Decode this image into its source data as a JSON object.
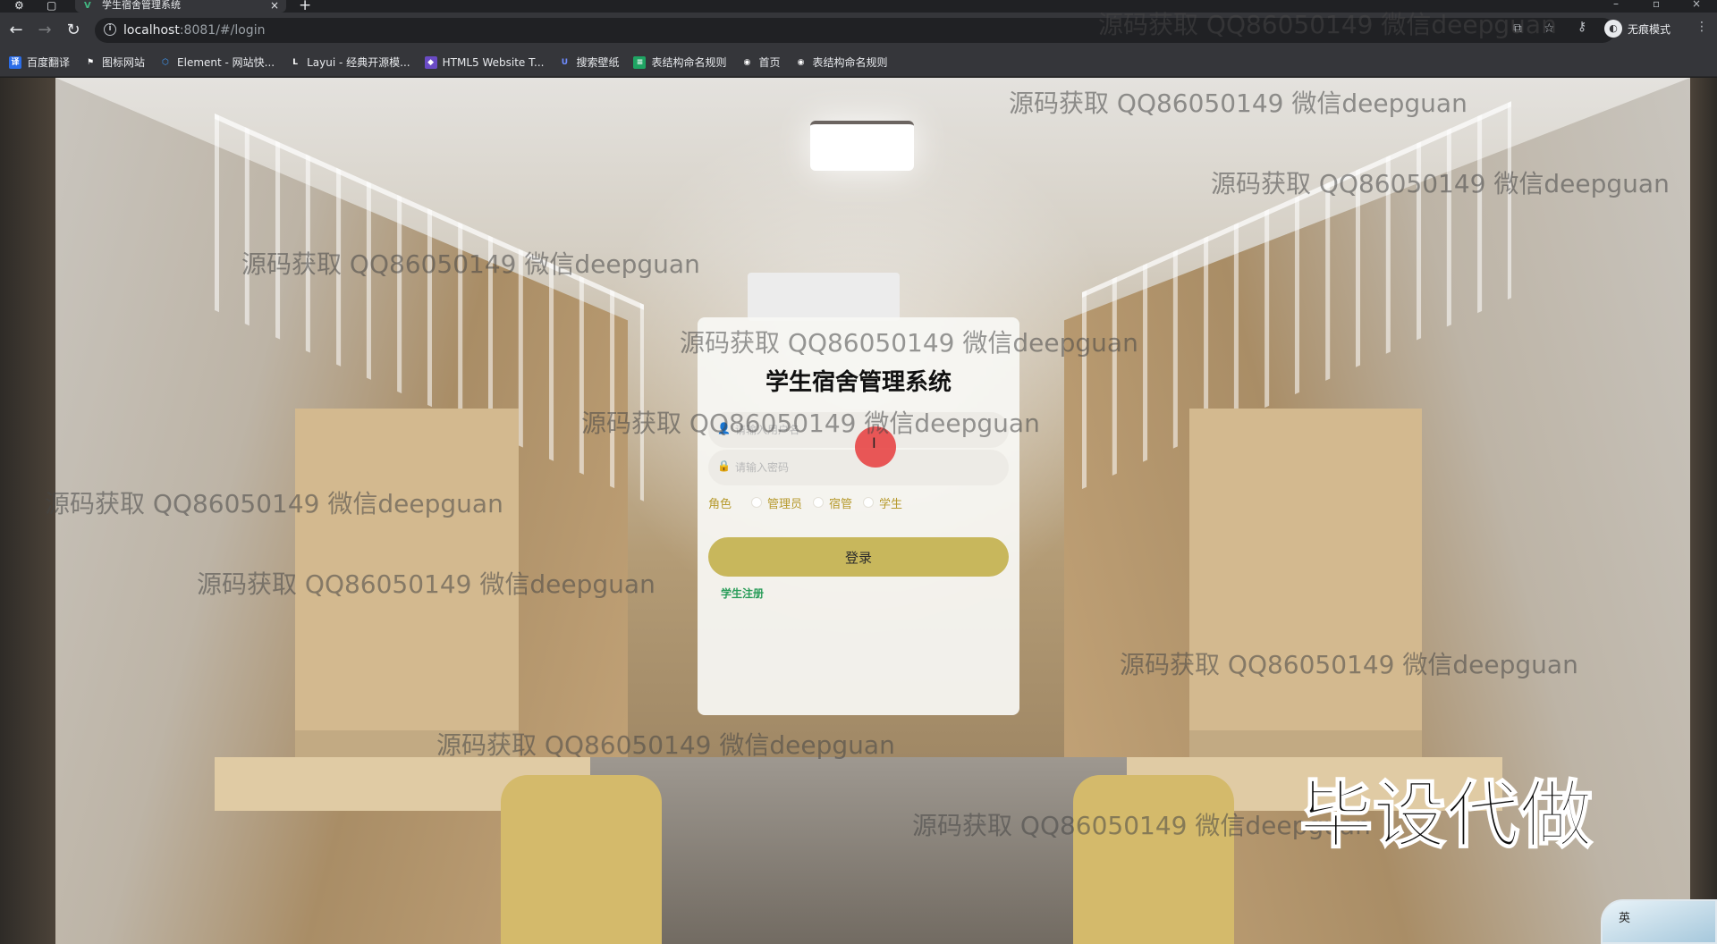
{
  "browser": {
    "tab_title": "学生宿舍管理系统",
    "tab_favicon": "vue-icon",
    "tab_close": "×",
    "new_tab": "+",
    "url_host": "localhost",
    "url_path": ":8081/#/login",
    "incognito_label": "无痕模式",
    "bookmarks": [
      {
        "label": "百度翻译",
        "icon": "translate-icon",
        "color": "#2b6de8",
        "glyph": "译"
      },
      {
        "label": "图标网站",
        "icon": "flag-icon",
        "color": "#35363a",
        "glyph": "⚑"
      },
      {
        "label": "Element - 网站快...",
        "icon": "element-icon",
        "color": "#409eff",
        "glyph": "⬡"
      },
      {
        "label": "Layui - 经典开源模...",
        "icon": "layui-icon",
        "color": "#35363a",
        "glyph": "L"
      },
      {
        "label": "HTML5 Website T...",
        "icon": "html5-icon",
        "color": "#6a4bc4",
        "glyph": "◆"
      },
      {
        "label": "搜索壁纸",
        "icon": "wallpaper-icon",
        "color": "#3b5bd9",
        "glyph": "U"
      },
      {
        "label": "表结构命名规则",
        "icon": "sheet-icon",
        "color": "#1fa463",
        "glyph": "≡"
      },
      {
        "label": "首页",
        "icon": "globe-icon",
        "color": "#5f6368",
        "glyph": "◉"
      },
      {
        "label": "表结构命名规则",
        "icon": "globe-icon",
        "color": "#5f6368",
        "glyph": "◉"
      }
    ]
  },
  "login": {
    "title": "学生宿舍管理系统",
    "username_placeholder": "请输入用户名",
    "password_placeholder": "请输入密码",
    "role_label": "角色",
    "roles": [
      "管理员",
      "宿管",
      "学生"
    ],
    "submit_label": "登录",
    "register_label": "学生注册"
  },
  "overlay": {
    "watermark_text": "源码获取 QQ86050149 微信deepguan",
    "promo_text": "毕设代做",
    "ime_label": "英"
  },
  "colors": {
    "accent_button": "#c8b75c",
    "role_text": "#b79a2e",
    "register_link": "#2a9d5a"
  }
}
